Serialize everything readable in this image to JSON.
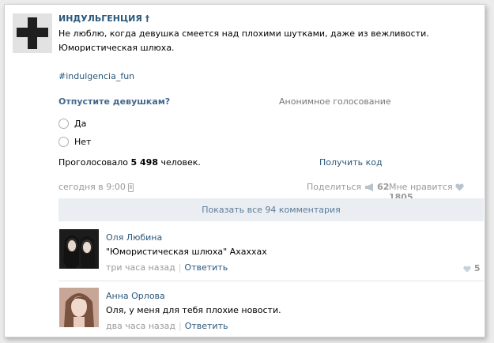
{
  "post": {
    "author": "ИНДУЛЬГЕНЦИЯ †",
    "text_line1": "Не люблю, когда девушка смеется над плохими шутками, даже из вежливости.",
    "text_line2": "Юмористическая шлюха.",
    "hashtag": "#indulgencia_fun"
  },
  "poll": {
    "question": "Отпустите девушкам?",
    "type_label": "Анонимное голосование",
    "options": [
      "Да",
      "Нет"
    ],
    "voted_prefix": "Проголосовало",
    "voted_count": "5 498",
    "voted_suffix": "человек.",
    "get_code": "Получить код"
  },
  "meta": {
    "time": "сегодня в 9:00",
    "share_label": "Поделиться",
    "share_count": "62",
    "like_label": "Мне нравится",
    "like_count": "1805"
  },
  "show_all_comments": "Показать все 94 комментария",
  "comments": [
    {
      "name": "Оля Любина",
      "text": "\"Юмористическая шлюха\" Ахахxах",
      "time": "три часа назад",
      "reply": "Ответить",
      "likes": "5"
    },
    {
      "name": "Анна Орлова",
      "text": "Оля, у меня для тебя плохие новости.",
      "time": "два часа назад",
      "reply": "Ответить"
    }
  ],
  "colors": {
    "link": "#2b587a",
    "muted": "#999999",
    "show_all_bg": "#eaeef2"
  }
}
